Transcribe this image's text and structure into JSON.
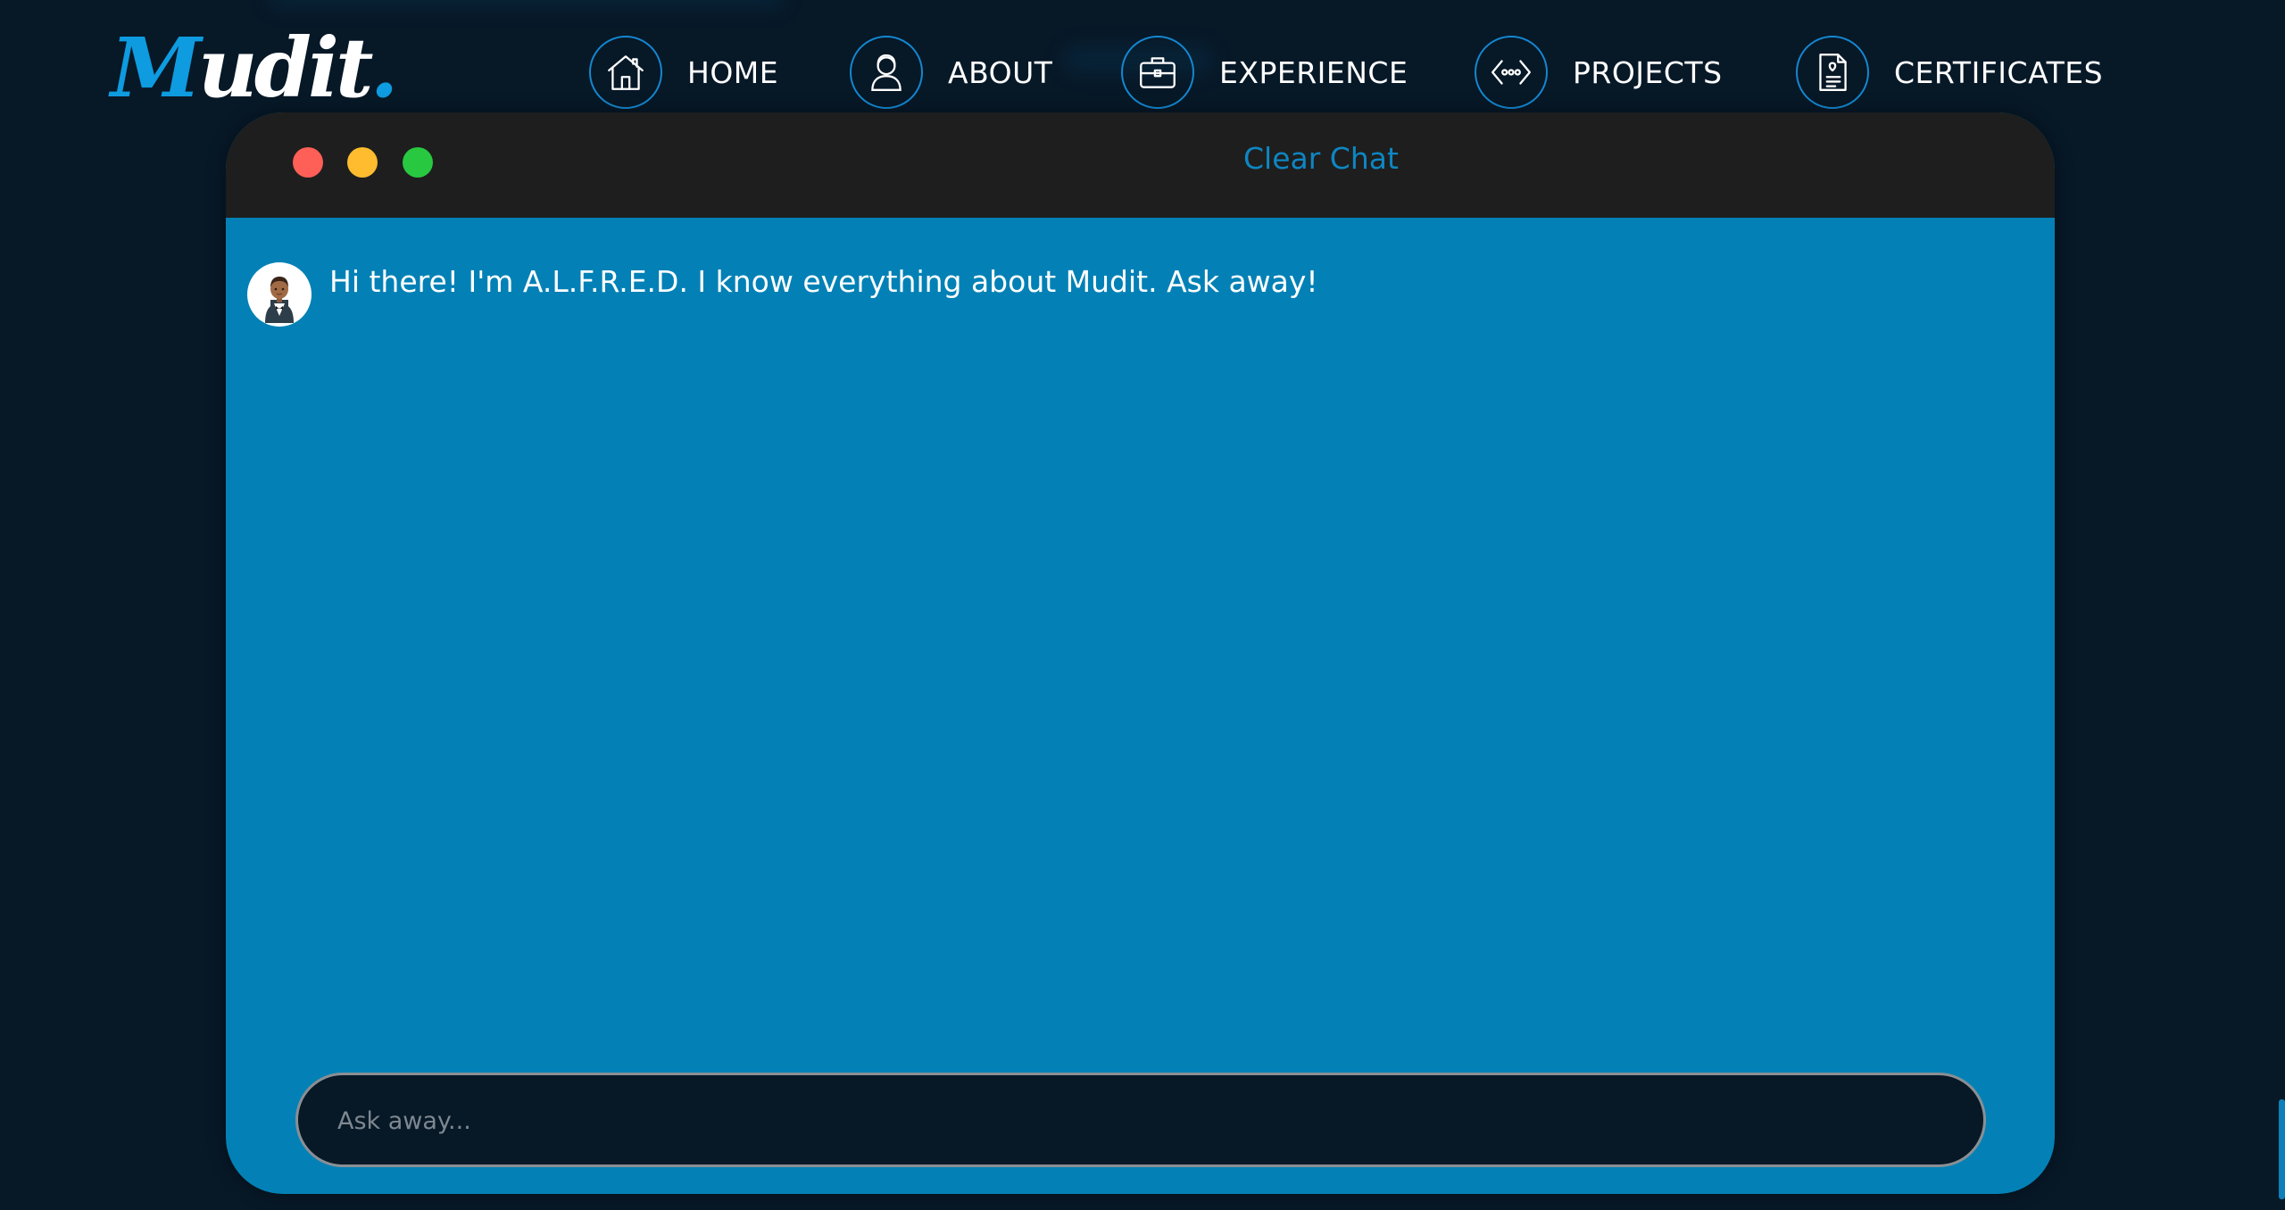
{
  "logo": {
    "first": "M",
    "rest": "udit",
    "dot": "."
  },
  "nav": {
    "items": [
      {
        "label": "HOME",
        "icon": "home-icon"
      },
      {
        "label": "ABOUT",
        "icon": "user-icon"
      },
      {
        "label": "EXPERIENCE",
        "icon": "briefcase-icon"
      },
      {
        "label": "PROJECTS",
        "icon": "code-icon"
      },
      {
        "label": "CERTIFICATES",
        "icon": "certificate-icon"
      }
    ]
  },
  "chat": {
    "clear_label": "Clear Chat",
    "messages": [
      {
        "sender": "bot",
        "avatar": "butler-avatar",
        "text": "Hi there! I'm A.L.F.R.E.D. I know everything about Mudit. Ask away!"
      }
    ],
    "input": {
      "placeholder": "Ask away...",
      "value": ""
    }
  },
  "colors": {
    "background": "#071827",
    "accent": "#0e9be0",
    "chat_body": "#0381b6",
    "titlebar": "#1e1e1e",
    "close": "#fe5f57",
    "minimize": "#febc2e",
    "maximize": "#28c840"
  }
}
